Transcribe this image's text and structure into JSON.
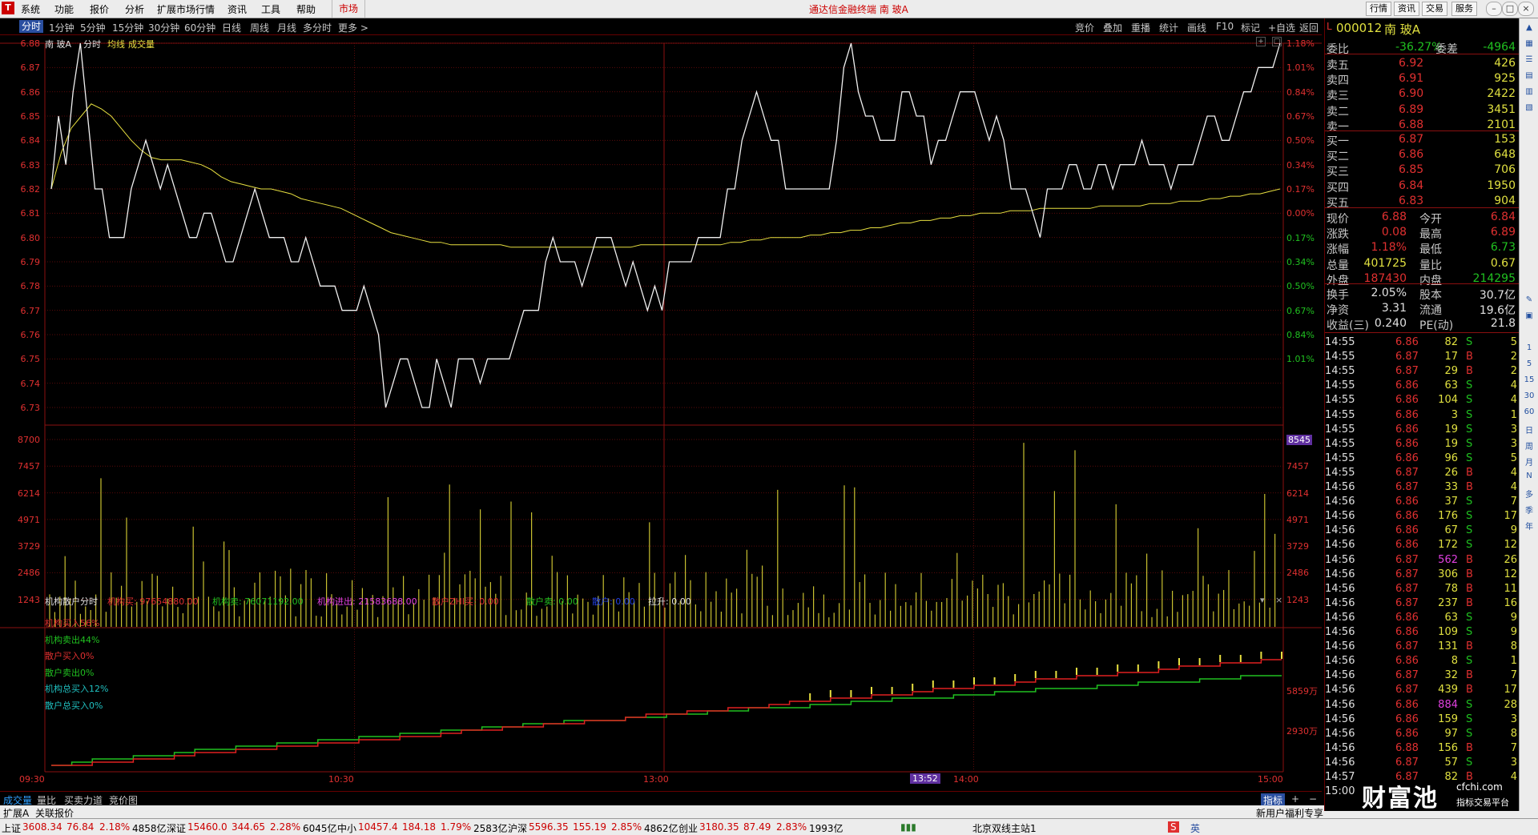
{
  "menubar": {
    "logo": "T",
    "items": [
      "系统",
      "功能",
      "报价",
      "分析",
      "扩展市场行情",
      "资讯",
      "工具",
      "帮助"
    ],
    "market_tab": "市场",
    "title": "通达信金融终端 南 玻A",
    "right_buttons": [
      "行情",
      "资讯",
      "交易",
      "服务"
    ]
  },
  "periods": [
    "分时",
    "1分钟",
    "5分钟",
    "15分钟",
    "30分钟",
    "60分钟",
    "日线",
    "周线",
    "月线",
    "多分时",
    "更多 >"
  ],
  "toolbar_right": [
    "竞价",
    "叠加",
    "重播",
    "统计",
    "画线",
    "F10",
    "标记",
    "+自选",
    "返回"
  ],
  "chart_header": {
    "name": "南 玻A",
    "mode": "分时",
    "avg_label": "均线",
    "vol_label": "成交量"
  },
  "price_axis": [
    "6.88",
    "6.87",
    "6.86",
    "6.85",
    "6.84",
    "6.83",
    "6.82",
    "6.81",
    "6.80",
    "6.79",
    "6.78",
    "6.77",
    "6.76",
    "6.75",
    "6.74",
    "6.73"
  ],
  "pct_axis": [
    "1.18%",
    "1.01%",
    "0.84%",
    "0.67%",
    "0.50%",
    "0.34%",
    "0.17%",
    "0.00%",
    "0.17%",
    "0.34%",
    "0.50%",
    "0.67%",
    "0.84%",
    "1.01%"
  ],
  "volume_axis": [
    "8700",
    "7457",
    "6214",
    "4971",
    "3729",
    "2486",
    "1243"
  ],
  "volume_axis_right": [
    "8545",
    "7457",
    "6214",
    "4971",
    "3729",
    "2486",
    "1243"
  ],
  "indicator": {
    "title": "机构散户分时",
    "fields": [
      {
        "label": "机构买:",
        "value": "97654880.00",
        "color": "#e03030"
      },
      {
        "label": "机构卖:",
        "value": "76071192.00",
        "color": "#20c020"
      },
      {
        "label": "机构进出:",
        "value": "21583688.00",
        "color": "#e040e0"
      },
      {
        "label": "散户ZHI买:",
        "value": "0.00",
        "color": "#e03030"
      },
      {
        "label": "散户卖:",
        "value": "0.00",
        "color": "#20c020"
      },
      {
        "label": "散户:",
        "value": "0.00",
        "color": "#2040e0"
      },
      {
        "label": "拉升:",
        "value": "0.00",
        "color": "#e0e0e0"
      }
    ],
    "legend": [
      {
        "text": "机构买入56%",
        "color": "#e03030"
      },
      {
        "text": "机构卖出44%",
        "color": "#20c020"
      },
      {
        "text": "散户买入0%",
        "color": "#e03030"
      },
      {
        "text": "散户卖出0%",
        "color": "#20c020"
      },
      {
        "text": "机构总买入12%",
        "color": "#20c0c0"
      },
      {
        "text": "散户总买入0%",
        "color": "#20c0c0"
      }
    ],
    "axis": [
      "5859万",
      "2930万"
    ]
  },
  "time_axis": [
    "09:30",
    "10:30",
    "13:00",
    "14:00",
    "15:00"
  ],
  "cursor_time": "13:52",
  "bottom_tabs": [
    "成交量",
    "量比",
    "买卖力道",
    "竞价图"
  ],
  "bottom_right": [
    "指标",
    "+",
    "−"
  ],
  "ext_bar": [
    "扩展A",
    "关联报价"
  ],
  "quote": {
    "code": "000012",
    "name": "南 玻A",
    "weibi_label": "委比",
    "weibi": "-36.27%",
    "weicha_label": "委差",
    "weicha": "-4964",
    "asks": [
      {
        "label": "卖五",
        "price": "6.92",
        "vol": "426"
      },
      {
        "label": "卖四",
        "price": "6.91",
        "vol": "925"
      },
      {
        "label": "卖三",
        "price": "6.90",
        "vol": "2422"
      },
      {
        "label": "卖二",
        "price": "6.89",
        "vol": "3451"
      },
      {
        "label": "卖一",
        "price": "6.88",
        "vol": "2101"
      }
    ],
    "bids": [
      {
        "label": "买一",
        "price": "6.87",
        "vol": "153"
      },
      {
        "label": "买二",
        "price": "6.86",
        "vol": "648"
      },
      {
        "label": "买三",
        "price": "6.85",
        "vol": "706"
      },
      {
        "label": "买四",
        "price": "6.84",
        "vol": "1950"
      },
      {
        "label": "买五",
        "price": "6.83",
        "vol": "904"
      }
    ],
    "stats": [
      {
        "l1": "现价",
        "v1": "6.88",
        "l2": "今开",
        "v2": "6.84"
      },
      {
        "l1": "涨跌",
        "v1": "0.08",
        "l2": "最高",
        "v2": "6.89"
      },
      {
        "l1": "涨幅",
        "v1": "1.18%",
        "l2": "最低",
        "v2": "6.73"
      },
      {
        "l1": "总量",
        "v1": "401725",
        "l2": "量比",
        "v2": "0.67"
      },
      {
        "l1": "外盘",
        "v1": "187430",
        "l2": "内盘",
        "v2": "214295"
      }
    ],
    "stats2": [
      {
        "l1": "换手",
        "v1": "2.05%",
        "l2": "股本",
        "v2": "30.7亿"
      },
      {
        "l1": "净资",
        "v1": "3.31",
        "l2": "流通",
        "v2": "19.6亿"
      },
      {
        "l1": "收益(三)",
        "v1": "0.240",
        "l2": "PE(动)",
        "v2": "21.8"
      }
    ]
  },
  "ticks": [
    [
      "14:55",
      "6.86",
      "82",
      "S",
      "5"
    ],
    [
      "14:55",
      "6.87",
      "17",
      "B",
      "2"
    ],
    [
      "14:55",
      "6.87",
      "29",
      "B",
      "2"
    ],
    [
      "14:55",
      "6.86",
      "63",
      "S",
      "4"
    ],
    [
      "14:55",
      "6.86",
      "104",
      "S",
      "4"
    ],
    [
      "14:55",
      "6.86",
      "3",
      "S",
      "1"
    ],
    [
      "14:55",
      "6.86",
      "19",
      "S",
      "3"
    ],
    [
      "14:55",
      "6.86",
      "19",
      "S",
      "3"
    ],
    [
      "14:55",
      "6.86",
      "96",
      "S",
      "5"
    ],
    [
      "14:55",
      "6.87",
      "26",
      "B",
      "4"
    ],
    [
      "14:56",
      "6.87",
      "33",
      "B",
      "4"
    ],
    [
      "14:56",
      "6.86",
      "37",
      "S",
      "7"
    ],
    [
      "14:56",
      "6.86",
      "176",
      "S",
      "17"
    ],
    [
      "14:56",
      "6.86",
      "67",
      "S",
      "9"
    ],
    [
      "14:56",
      "6.86",
      "172",
      "S",
      "12"
    ],
    [
      "14:56",
      "6.87",
      "562",
      "B",
      "26"
    ],
    [
      "14:56",
      "6.87",
      "306",
      "B",
      "12"
    ],
    [
      "14:56",
      "6.87",
      "78",
      "B",
      "11"
    ],
    [
      "14:56",
      "6.87",
      "237",
      "B",
      "16"
    ],
    [
      "14:56",
      "6.86",
      "63",
      "S",
      "9"
    ],
    [
      "14:56",
      "6.86",
      "109",
      "S",
      "9"
    ],
    [
      "14:56",
      "6.87",
      "131",
      "B",
      "8"
    ],
    [
      "14:56",
      "6.86",
      "8",
      "S",
      "1"
    ],
    [
      "14:56",
      "6.87",
      "32",
      "B",
      "7"
    ],
    [
      "14:56",
      "6.87",
      "439",
      "B",
      "17"
    ],
    [
      "14:56",
      "6.86",
      "884",
      "S",
      "28"
    ],
    [
      "14:56",
      "6.86",
      "159",
      "S",
      "3"
    ],
    [
      "14:56",
      "6.86",
      "97",
      "S",
      "8"
    ],
    [
      "14:56",
      "6.88",
      "156",
      "B",
      "7"
    ],
    [
      "14:56",
      "6.87",
      "57",
      "S",
      "3"
    ],
    [
      "14:57",
      "6.87",
      "82",
      "B",
      "4"
    ],
    [
      "15:00",
      "",
      "",
      "",
      ""
    ]
  ],
  "status": [
    {
      "name": "上证",
      "val": "3608.34",
      "chg": "76.84",
      "pct": "2.18%",
      "amt": "4858亿"
    },
    {
      "name": "深证",
      "val": "15460.0",
      "chg": "344.65",
      "pct": "2.28%",
      "amt": "6045亿"
    },
    {
      "name": "中小",
      "val": "10457.4",
      "chg": "184.18",
      "pct": "1.79%",
      "amt": "2583亿"
    },
    {
      "name": "沪深",
      "val": "5596.35",
      "chg": "155.19",
      "pct": "2.85%",
      "amt": "4862亿"
    },
    {
      "name": "创业",
      "val": "3180.35",
      "chg": "87.49",
      "pct": "2.83%",
      "amt": "1993亿"
    }
  ],
  "server": "北京双线主站1",
  "promo": "新用户福利专享",
  "watermark": {
    "cn": "财富池",
    "url": "cfchi.com",
    "sub": "指标交易平台"
  },
  "ime": "英",
  "chart_data": {
    "type": "line",
    "ylim": [
      6.73,
      6.88
    ],
    "prev_close": 6.8,
    "price": [
      6.82,
      6.85,
      6.83,
      6.86,
      6.88,
      6.85,
      6.82,
      6.82,
      6.8,
      6.8,
      6.8,
      6.82,
      6.83,
      6.84,
      6.83,
      6.82,
      6.83,
      6.82,
      6.81,
      6.8,
      6.8,
      6.81,
      6.81,
      6.8,
      6.79,
      6.79,
      6.8,
      6.81,
      6.82,
      6.81,
      6.8,
      6.8,
      6.8,
      6.79,
      6.79,
      6.8,
      6.79,
      6.78,
      6.78,
      6.78,
      6.77,
      6.77,
      6.77,
      6.78,
      6.77,
      6.76,
      6.73,
      6.74,
      6.75,
      6.75,
      6.74,
      6.73,
      6.73,
      6.75,
      6.74,
      6.73,
      6.75,
      6.75,
      6.75,
      6.74,
      6.75,
      6.75,
      6.75,
      6.75,
      6.76,
      6.77,
      6.77,
      6.77,
      6.79,
      6.8,
      6.79,
      6.79,
      6.79,
      6.78,
      6.79,
      6.8,
      6.8,
      6.8,
      6.79,
      6.78,
      6.79,
      6.78,
      6.77,
      6.78,
      6.77,
      6.79,
      6.79,
      6.79,
      6.79,
      6.8,
      6.8,
      6.8,
      6.8,
      6.82,
      6.82,
      6.84,
      6.85,
      6.86,
      6.85,
      6.84,
      6.84,
      6.82,
      6.82,
      6.82,
      6.82,
      6.82,
      6.82,
      6.82,
      6.84,
      6.87,
      6.88,
      6.86,
      6.85,
      6.85,
      6.84,
      6.84,
      6.84,
      6.86,
      6.86,
      6.85,
      6.85,
      6.83,
      6.84,
      6.84,
      6.85,
      6.86,
      6.86,
      6.86,
      6.85,
      6.84,
      6.85,
      6.84,
      6.82,
      6.82,
      6.82,
      6.81,
      6.8,
      6.82,
      6.82,
      6.82,
      6.83,
      6.83,
      6.82,
      6.82,
      6.83,
      6.83,
      6.82,
      6.83,
      6.83,
      6.83,
      6.84,
      6.83,
      6.83,
      6.83,
      6.82,
      6.83,
      6.83,
      6.83,
      6.84,
      6.85,
      6.85,
      6.84,
      6.84,
      6.85,
      6.86,
      6.86,
      6.87,
      6.87,
      6.87,
      6.88
    ],
    "avg": [
      6.82,
      6.835,
      6.845,
      6.85,
      6.855,
      6.853,
      6.85,
      6.845,
      6.84,
      6.836,
      6.833,
      6.832,
      6.832,
      6.832,
      6.831,
      6.83,
      6.828,
      6.825,
      6.823,
      6.822,
      6.821,
      6.82,
      6.82,
      6.819,
      6.818,
      6.816,
      6.815,
      6.814,
      6.813,
      6.812,
      6.81,
      6.808,
      6.806,
      6.804,
      6.802,
      6.801,
      6.8,
      6.799,
      6.798,
      6.798,
      6.797,
      6.797,
      6.797,
      6.797,
      6.797,
      6.797,
      6.796,
      6.796,
      6.796,
      6.796,
      6.796,
      6.796,
      6.796,
      6.796,
      6.796,
      6.796,
      6.796,
      6.796,
      6.796,
      6.797,
      6.797,
      6.797,
      6.797,
      6.797,
      6.797,
      6.797,
      6.797,
      6.797,
      6.798,
      6.798,
      6.799,
      6.799,
      6.8,
      6.8,
      6.8,
      6.8,
      6.801,
      6.801,
      6.802,
      6.802,
      6.803,
      6.803,
      6.804,
      6.804,
      6.805,
      6.806,
      6.806,
      6.807,
      6.807,
      6.808,
      6.808,
      6.809,
      6.809,
      6.81,
      6.81,
      6.81,
      6.811,
      6.811,
      6.811,
      6.812,
      6.812,
      6.812,
      6.812,
      6.812,
      6.812,
      6.813,
      6.813,
      6.813,
      6.813,
      6.813,
      6.814,
      6.814,
      6.814,
      6.815,
      6.815,
      6.815,
      6.816,
      6.816,
      6.817,
      6.817,
      6.818,
      6.818,
      6.819,
      6.82
    ],
    "volume_ylim": [
      0,
      8700
    ]
  }
}
